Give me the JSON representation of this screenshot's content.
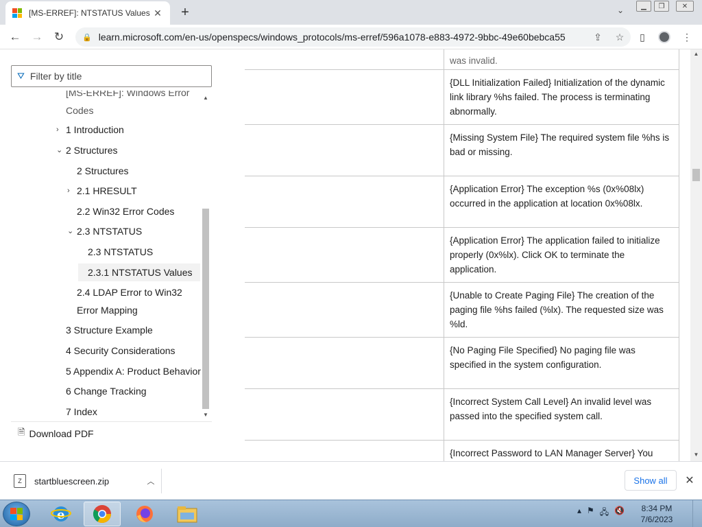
{
  "browser": {
    "tab_title": "[MS-ERREF]: NTSTATUS Values | Microsoft Learn",
    "tab_close": "✕",
    "new_tab": "+",
    "url": "learn.microsoft.com/en-us/openspecs/windows_protocols/ms-erref/596a1078-e883-4972-9bbc-49e60bebca55",
    "brand_colors": [
      "#f25022",
      "#7fba00",
      "#00a4ef",
      "#ffb900"
    ]
  },
  "sidebar": {
    "filter_placeholder": "Filter by title",
    "toc": [
      {
        "label": "[MS-ERREF]: Windows Error Codes",
        "level": 1
      },
      {
        "label": "1 Introduction",
        "level": 1,
        "expander": "›"
      },
      {
        "label": "2 Structures",
        "level": 1,
        "expander": "⌄"
      },
      {
        "label": "2 Structures",
        "level": 2
      },
      {
        "label": "2.1 HRESULT",
        "level": 2,
        "expander": "›"
      },
      {
        "label": "2.2 Win32 Error Codes",
        "level": 2
      },
      {
        "label": "2.3 NTSTATUS",
        "level": 2,
        "expander": "⌄"
      },
      {
        "label": "2.3 NTSTATUS",
        "level": 3
      },
      {
        "label": "2.3.1 NTSTATUS Values",
        "level": 3,
        "active": true
      },
      {
        "label": "2.4 LDAP Error to Win32 Error Mapping",
        "level": 2
      },
      {
        "label": "3 Structure Example",
        "level": 1
      },
      {
        "label": "4 Security Considerations",
        "level": 1
      },
      {
        "label": "5 Appendix A: Product Behavior",
        "level": 1
      },
      {
        "label": "6 Change Tracking",
        "level": 1
      },
      {
        "label": "7 Index",
        "level": 1
      }
    ],
    "download_pdf": "Download PDF"
  },
  "content": {
    "top_partial": "was invalid.",
    "rows": [
      "{DLL Initialization Failed} Initialization of the dynamic link library %hs failed. The process is terminating abnormally.",
      "{Missing System File} The required system file %hs is bad or missing.",
      "{Application Error} The exception %s (0x%08lx) occurred in the application at location 0x%08lx.",
      "{Application Error} The application failed to initialize properly (0x%lx). Click OK to terminate the application.",
      "{Unable to Create Paging File} The creation of the paging file %hs failed (%lx). The requested size was %ld.",
      "{No Paging File Specified} No paging file was specified in the system configuration.",
      "{Incorrect System Call Level} An invalid level was passed into the specified system call.",
      "{Incorrect Password to LAN Manager Server} You"
    ]
  },
  "downloads": {
    "file_name": "startbluescreen.zip",
    "show_all": "Show all"
  },
  "taskbar": {
    "time": "8:34 PM",
    "date": "7/6/2023"
  }
}
